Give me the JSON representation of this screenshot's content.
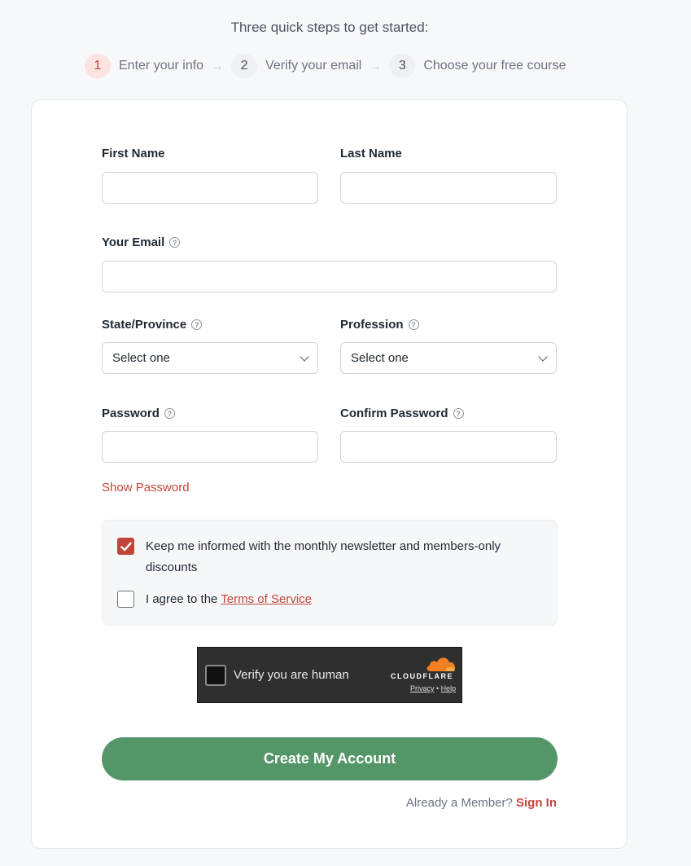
{
  "header": {
    "intro": "Three quick steps to get started:",
    "steps": [
      {
        "num": "1",
        "label": "Enter your info"
      },
      {
        "num": "2",
        "label": "Verify your email"
      },
      {
        "num": "3",
        "label": "Choose your free course"
      }
    ],
    "arrow": "→"
  },
  "form": {
    "first_name_label": "First Name",
    "last_name_label": "Last Name",
    "email_label": "Your Email",
    "state_label": "State/Province",
    "state_value": "Select one",
    "profession_label": "Profession",
    "profession_value": "Select one",
    "password_label": "Password",
    "confirm_password_label": "Confirm Password",
    "show_password": "Show Password",
    "help_glyph": "?",
    "newsletter_text": "Keep me informed with the monthly newsletter and members-only discounts",
    "newsletter_checked": true,
    "agree_prefix": "I agree to the ",
    "tos_link": "Terms of Service",
    "agree_checked": false,
    "submit_label": "Create My Account",
    "member_prefix": "Already a Member?",
    "sign_in": "Sign In"
  },
  "captcha": {
    "text": "Verify you are human",
    "brand": "CLOUDFLARE",
    "privacy": "Privacy",
    "separator": " • ",
    "help": "Help"
  },
  "colors": {
    "accent": "#c0463a",
    "button": "#559669",
    "captcha_bg": "#2f2f2f",
    "cloudflare_orange": "#f38020"
  }
}
